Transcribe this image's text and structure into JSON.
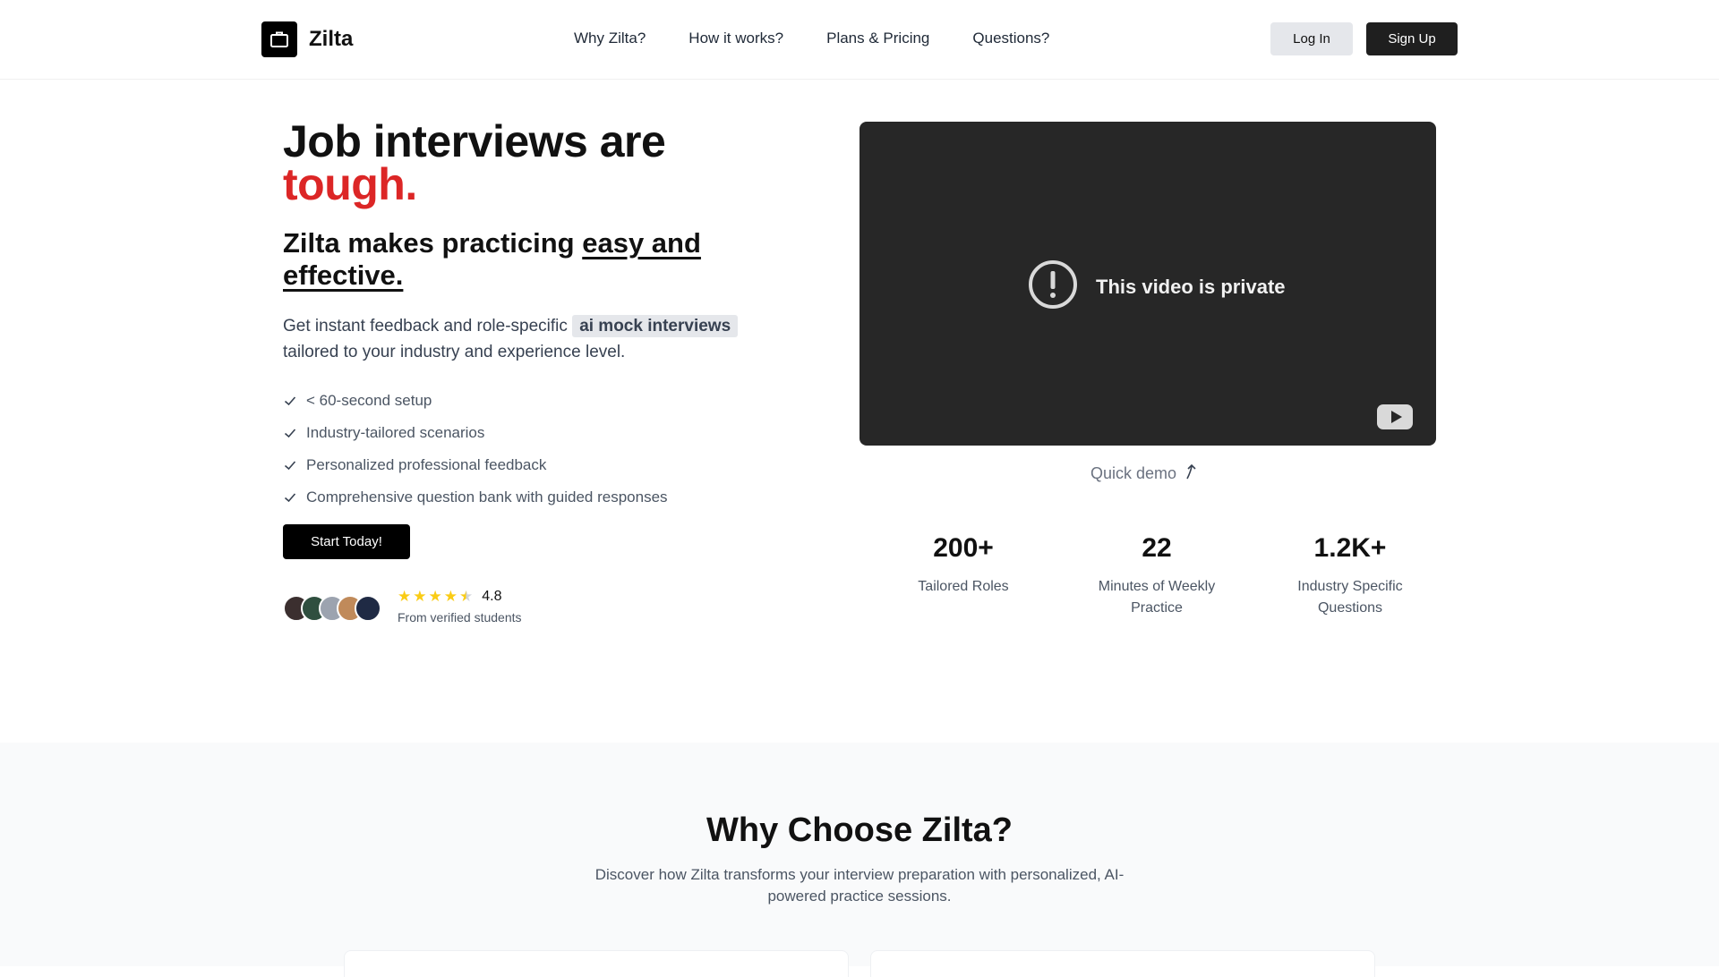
{
  "nav": {
    "brand": "Zilta",
    "links": [
      "Why Zilta?",
      "How it works?",
      "Plans & Pricing",
      "Questions?"
    ],
    "login_label": "Log In",
    "signup_label": "Sign Up"
  },
  "hero": {
    "title_line1": "Job interviews are",
    "title_accent": "tough.",
    "subtitle_prefix": "Zilta makes practicing ",
    "subtitle_underlined": "easy and effective.",
    "desc_prefix": "Get instant feedback and role-specific ",
    "desc_chip": "ai mock interviews",
    "desc_suffix": " tailored to your industry and experience level.",
    "features": [
      "< 60-second setup",
      "Industry-tailored scenarios",
      "Personalized professional feedback",
      "Comprehensive question bank with guided responses"
    ],
    "cta_label": "Start Today!",
    "rating_value": "4.8",
    "rating_stars": 4.5,
    "rating_caption": "From verified students",
    "avatar_colors": [
      "#3b2f2f",
      "#2f4f3f",
      "#9ca3af",
      "#c08a5a",
      "#1f2a44"
    ]
  },
  "video": {
    "message": "This video is private",
    "demo_label": "Quick demo"
  },
  "stats": [
    {
      "value": "200+",
      "label": "Tailored Roles"
    },
    {
      "value": "22",
      "label": "Minutes of Weekly Practice"
    },
    {
      "value": "1.2K+",
      "label": "Industry Specific Questions"
    }
  ],
  "why": {
    "title": "Why Choose Zilta?",
    "description": "Discover how Zilta transforms your interview preparation with personalized, AI-powered practice sessions."
  },
  "colors": {
    "accent": "#dc2626",
    "star": "#facc15",
    "video_bg": "#272727"
  }
}
